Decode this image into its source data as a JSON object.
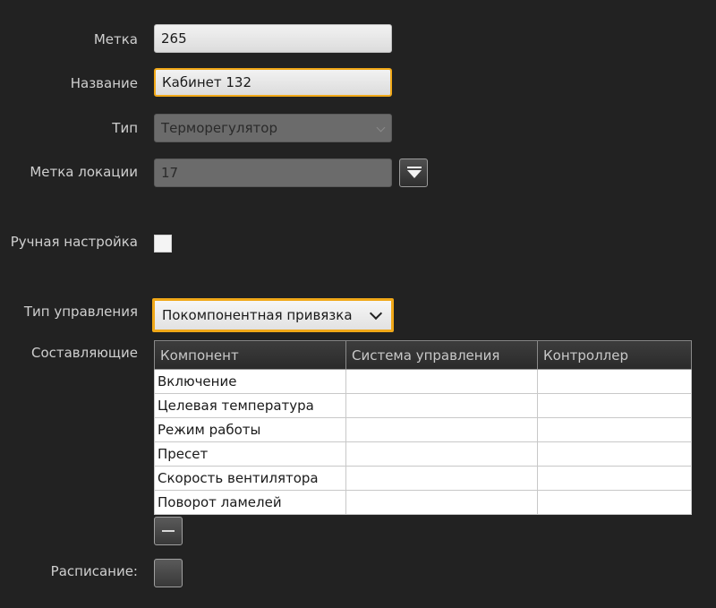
{
  "form": {
    "tag_label": "Метка",
    "tag_value": "265",
    "name_label": "Название",
    "name_value": "Кабинет 132",
    "type_label": "Тип",
    "type_value": "Терморегулятор",
    "location_label": "Метка локации",
    "location_value": "17",
    "manual_label": "Ручная настройка",
    "control_type_label": "Тип управления",
    "control_type_value": "Покомпонентная привязка",
    "components_label": "Составляющие",
    "schedule_label": "Расписание:"
  },
  "components_table": {
    "columns": [
      "Компонент",
      "Система управления",
      "Контроллер"
    ],
    "rows": [
      [
        "Включение",
        "",
        ""
      ],
      [
        "Целевая температура",
        "",
        ""
      ],
      [
        "Режим работы",
        "",
        ""
      ],
      [
        "Пресет",
        "",
        ""
      ],
      [
        "Скорость вентилятора",
        "",
        ""
      ],
      [
        "Поворот ламелей",
        "",
        ""
      ]
    ]
  },
  "colors": {
    "background": "#222222",
    "focus_accent": "#f0a818"
  },
  "icons": {
    "location_dropdown": "triangle-down-icon",
    "remove": "minus-icon"
  }
}
